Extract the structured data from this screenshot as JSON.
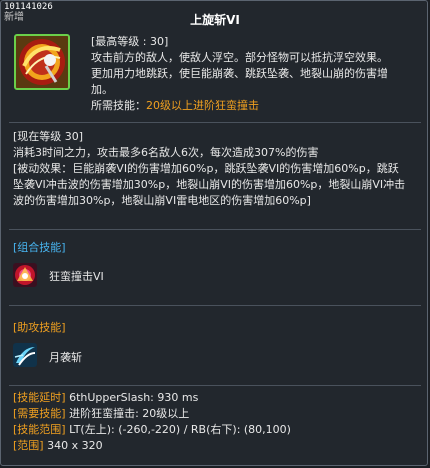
{
  "skill_id": "101141026",
  "new_tag": "新增",
  "title": "上旋斩VI",
  "header_desc": {
    "max_level": "[最高等级 : 30]",
    "lines": [
      "攻击前方的敌人，使敌人浮空。部分怪物可以抵抗浮空效果。",
      "更加用力地跳跃，使巨能崩袭、跳跃坠袭、地裂山崩的伤害增",
      "加。"
    ],
    "required_label": "所需技能：",
    "required_value": "20级以上进阶狂蛮撞击"
  },
  "current": {
    "level": "[现在等级 30]",
    "lines": [
      "消耗3时间之力，攻击最多6名敌人6次，每次造成307%的伤害",
      "[被动效果：巨能崩袭VI的伤害增加60%p，跳跃坠袭VI的伤害增加60%p，跳跃",
      "坠袭VI冲击波的伤害增加30%p，地裂山崩VI的伤害增加60%p，地裂山崩VI冲击",
      "波的伤害增加30%p，地裂山崩VI雷电地区的伤害增加60%p]"
    ]
  },
  "combo": {
    "title": "[组合技能]",
    "skill_name": "狂蛮撞击VI",
    "icon": "fire-burst-icon"
  },
  "assist": {
    "title": "[助攻技能]",
    "skill_name": "月袭斩",
    "icon": "crescent-slash-icon"
  },
  "info": {
    "delay_k": "[技能延时]",
    "delay_v": " 6thUpperSlash: 930 ms",
    "req_k": "[需要技能]",
    "req_v": " 进阶狂蛮撞击: 20级以上",
    "range_k": "[技能范围]",
    "range_v": " LT(左上): (-260,-220) / RB(右下): (80,100)",
    "area_k": "[范围]",
    "area_v": " 340 x 320"
  },
  "colors": {
    "accent_orange": "#f0a020",
    "section_blue": "#48b4f0",
    "icon_border_green": "#6bd04a"
  }
}
